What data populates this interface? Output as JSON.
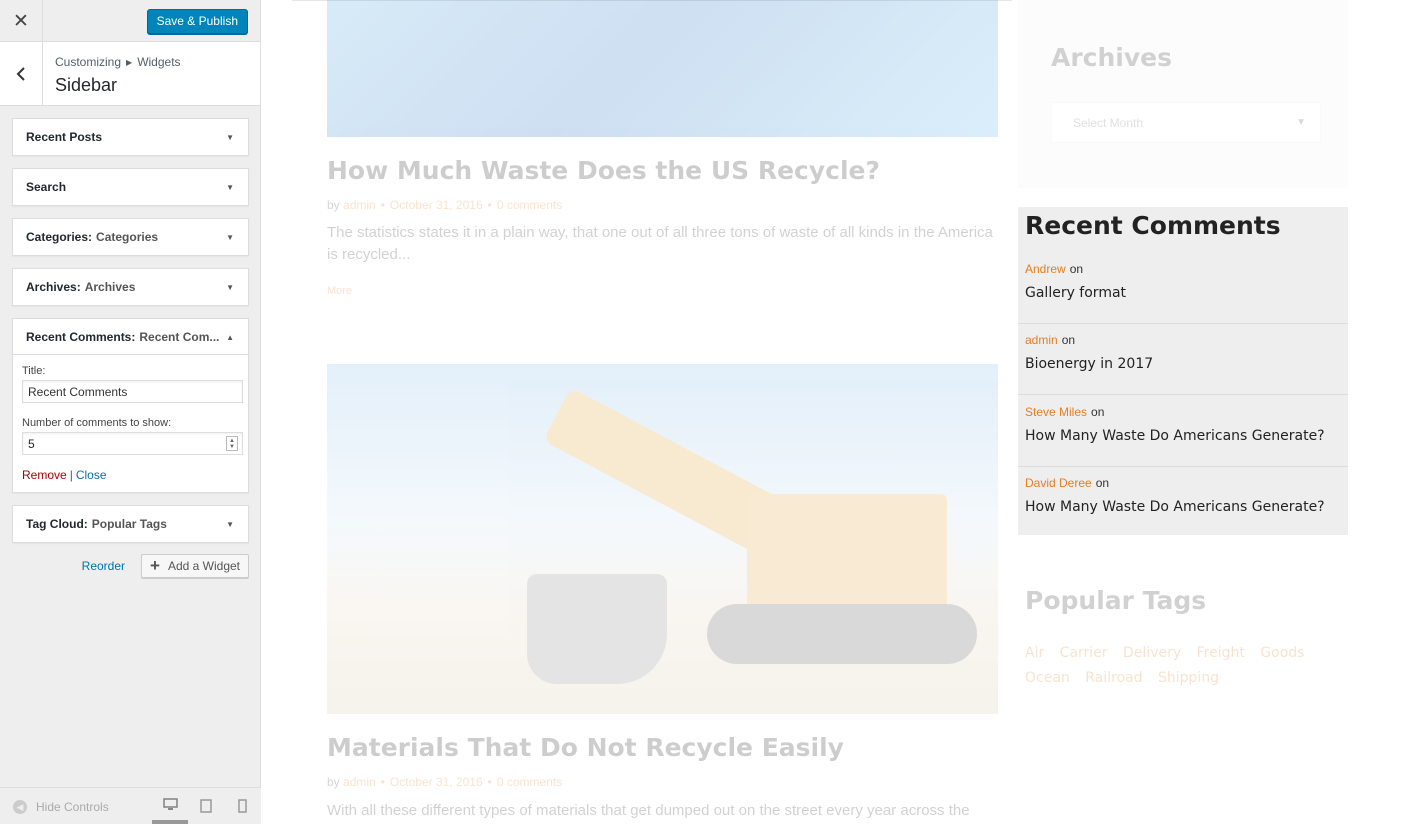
{
  "customizer": {
    "close_glyph": "✕",
    "publish_label": "Save & Publish",
    "breadcrumb": [
      "Customizing",
      "Widgets"
    ],
    "section_title": "Sidebar",
    "widgets": [
      {
        "name": "Recent Posts",
        "instance": ""
      },
      {
        "name": "Search",
        "instance": ""
      },
      {
        "name": "Categories:",
        "instance": "Categories"
      },
      {
        "name": "Archives:",
        "instance": "Archives"
      },
      {
        "name": "Recent Comments:",
        "instance": "Recent Com..."
      },
      {
        "name": "Tag Cloud:",
        "instance": "Popular Tags"
      }
    ],
    "open_widget": {
      "title_label": "Title:",
      "title_value": "Recent Comments",
      "count_label": "Number of comments to show:",
      "count_value": "5",
      "remove_label": "Remove",
      "separator": "|",
      "close_label": "Close"
    },
    "reorder_label": "Reorder",
    "add_widget_label": "Add a Widget",
    "hide_controls_label": "Hide Controls"
  },
  "preview": {
    "posts": [
      {
        "title": "How Much Waste Does the US Recycle?",
        "by": "by",
        "author": "admin",
        "date": "October 31, 2016",
        "comments": "0 comments",
        "excerpt": "The statistics states it in a plain way, that one out of all three tons of waste of all kinds in the America is recycled...",
        "more": "More"
      },
      {
        "title": "Materials That Do Not Recycle Easily",
        "by": "by",
        "author": "admin",
        "date": "October 31, 2016",
        "comments": "0 comments",
        "excerpt": "With all these different types of materials that get dumped out on the street every year across the cities"
      }
    ],
    "archives": {
      "title": "Archives",
      "select_placeholder": "Select Month"
    },
    "recent_comments": {
      "title": "Recent Comments",
      "on_word": "on",
      "items": [
        {
          "author": "Andrew",
          "post": "Gallery format"
        },
        {
          "author": "admin",
          "post": "Bioenergy in 2017"
        },
        {
          "author": "Steve Miles",
          "post": "How Many Waste Do Americans Generate?"
        },
        {
          "author": "David Deree",
          "post": "How Many Waste Do Americans Generate?"
        }
      ]
    },
    "popular_tags": {
      "title": "Popular Tags",
      "tags": [
        "Air",
        "Carrier",
        "Delivery",
        "Freight",
        "Goods",
        "Ocean",
        "Railroad",
        "Shipping"
      ]
    }
  },
  "colors": {
    "publish": "#0085ba",
    "accent": "#e67e22",
    "link": "#0073aa",
    "remove": "#aa0000"
  }
}
